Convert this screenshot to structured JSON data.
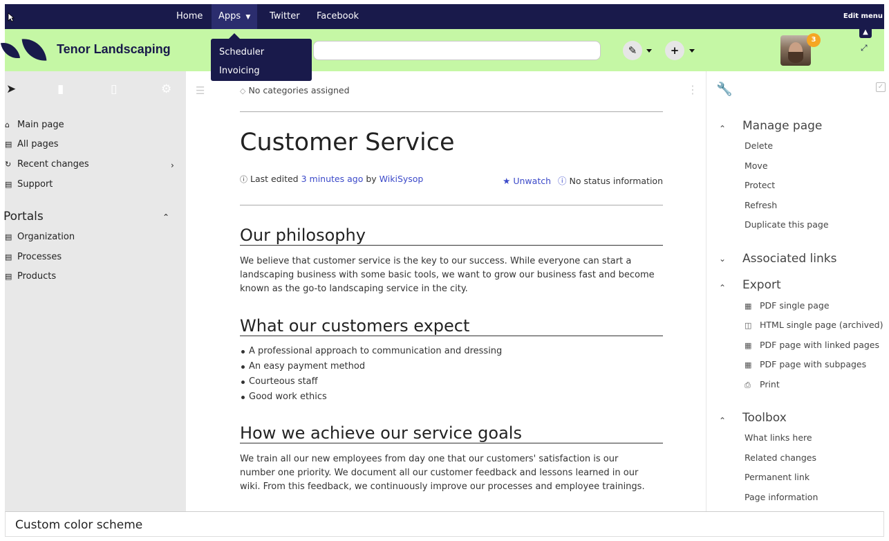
{
  "topnav": {
    "home": "Home",
    "apps": "Apps",
    "twitter": "Twitter",
    "facebook": "Facebook",
    "edit_menu": "Edit menu"
  },
  "apps_dropdown": {
    "items": [
      "Scheduler",
      "Invoicing"
    ]
  },
  "header": {
    "brand": "Tenor Landscaping",
    "notification_count": "3",
    "edit_icon": "pencil-icon",
    "add_icon": "plus-icon"
  },
  "left_sidebar": {
    "tab_icons": [
      "navigation-icon",
      "book-icon",
      "clipboard-icon",
      "gear-icon"
    ],
    "nav_items": [
      {
        "label": "Main page",
        "icon": "home-icon"
      },
      {
        "label": "All pages",
        "icon": "page-icon"
      },
      {
        "label": "Recent changes",
        "icon": "history-icon"
      },
      {
        "label": "Support",
        "icon": "page-icon"
      }
    ],
    "portals_heading": "Portals",
    "portal_items": [
      "Organization",
      "Processes",
      "Products"
    ]
  },
  "main": {
    "categories": "No categories assigned",
    "title": "Customer Service",
    "meta": {
      "prefix": "Last edited",
      "time_link": "3 minutes ago",
      "by": "by",
      "user_link": "WikiSysop",
      "unwatch": "Unwatch",
      "status": "No status information"
    },
    "sections": [
      {
        "heading": "Our philosophy",
        "paragraph": "We believe that customer service is the key to our success. While everyone can start a landscaping business with some basic tools, we want to grow our business fast and become known as the go-to landscaping service in the city."
      },
      {
        "heading": "What our customers expect",
        "bullets": [
          "A professional approach to communication and dressing",
          "An easy payment method",
          "Courteous staff",
          "Good work ethics"
        ]
      },
      {
        "heading": "How we achieve our service goals",
        "paragraph": "We train all our new employees from day one that our customers' satisfaction is our number one priority. We document all our customer feedback and lessons learned in our wiki. From this feedback, we continuously improve our processes and employee trainings."
      }
    ]
  },
  "right_sidebar": {
    "manage_page": {
      "heading": "Manage page",
      "items": [
        "Delete",
        "Move",
        "Protect",
        "Refresh",
        "Duplicate this page"
      ]
    },
    "associated_links": {
      "heading": "Associated links"
    },
    "export": {
      "heading": "Export",
      "items": [
        {
          "label": "PDF single page",
          "icon": "pdf-icon"
        },
        {
          "label": "HTML single page (archived)",
          "icon": "archive-icon"
        },
        {
          "label": "PDF page with linked pages",
          "icon": "pdf-icon"
        },
        {
          "label": "PDF page with subpages",
          "icon": "pdf-icon"
        },
        {
          "label": "Print",
          "icon": "print-icon"
        }
      ]
    },
    "toolbox": {
      "heading": "Toolbox",
      "items": [
        "What links here",
        "Related changes",
        "Permanent link",
        "Page information"
      ]
    }
  },
  "caption": "Custom color scheme",
  "colors": {
    "navy": "#191a4b",
    "header_green": "#c5f7a5",
    "link_blue": "#3b49c9",
    "badge_orange": "#f5a623",
    "sidebar_gray": "#e8e8e8"
  }
}
